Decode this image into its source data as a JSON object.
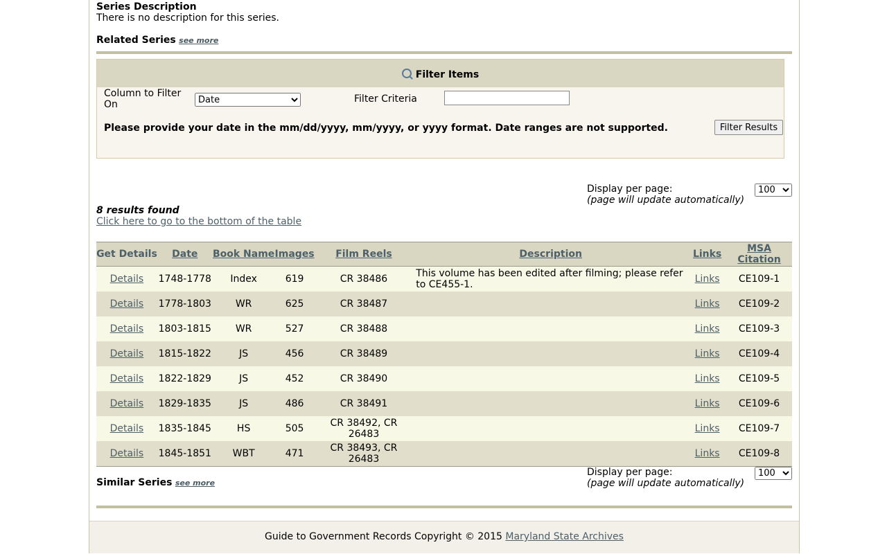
{
  "series_description": {
    "heading": "Series Description",
    "text": "There is no description for this series."
  },
  "related_series": {
    "heading": "Related Series",
    "see_more": "see more"
  },
  "filter": {
    "title": "Filter Items",
    "column_label": "Column to Filter On",
    "column_selected": "Date",
    "criteria_label": "Filter Criteria",
    "criteria_value": "",
    "hint": "Please provide your date in the mm/dd/yyyy, mm/yyyy, or yyyy format. Date ranges are not supported.",
    "button": "Filter Results"
  },
  "display_top": {
    "label": "Display per page:",
    "note": "(page will update automatically)",
    "selected": "100"
  },
  "results": {
    "count_text": "8 results found",
    "bottom_link": "Click here to go to the bottom of the table"
  },
  "table": {
    "headers": {
      "get_details": "Get Details",
      "date": "Date",
      "book_name": "Book Name",
      "images": "Images",
      "film_reels": "Film Reels",
      "description": "Description",
      "links": "Links",
      "msa_citation": "MSA Citation"
    },
    "rows": [
      {
        "details": "Details",
        "date": "1748-1778",
        "book": "Index",
        "images": "619",
        "reels": "CR 38486",
        "description": "This volume has been edited after filming; please refer to CE455-1.",
        "links": "Links",
        "citation": "CE109-1"
      },
      {
        "details": "Details",
        "date": "1778-1803",
        "book": "WR",
        "images": "625",
        "reels": "CR 38487",
        "description": "",
        "links": "Links",
        "citation": "CE109-2"
      },
      {
        "details": "Details",
        "date": "1803-1815",
        "book": "WR",
        "images": "527",
        "reels": "CR 38488",
        "description": "",
        "links": "Links",
        "citation": "CE109-3"
      },
      {
        "details": "Details",
        "date": "1815-1822",
        "book": "JS",
        "images": "456",
        "reels": "CR 38489",
        "description": "",
        "links": "Links",
        "citation": "CE109-4"
      },
      {
        "details": "Details",
        "date": "1822-1829",
        "book": "JS",
        "images": "452",
        "reels": "CR 38490",
        "description": "",
        "links": "Links",
        "citation": "CE109-5"
      },
      {
        "details": "Details",
        "date": "1829-1835",
        "book": "JS",
        "images": "486",
        "reels": "CR 38491",
        "description": "",
        "links": "Links",
        "citation": "CE109-6"
      },
      {
        "details": "Details",
        "date": "1835-1845",
        "book": "HS",
        "images": "505",
        "reels": "CR 38492, CR 26483",
        "description": "",
        "links": "Links",
        "citation": "CE109-7"
      },
      {
        "details": "Details",
        "date": "1845-1851",
        "book": "WBT",
        "images": "471",
        "reels": "CR 38493, CR 26483",
        "description": "",
        "links": "Links",
        "citation": "CE109-8"
      }
    ]
  },
  "similar_series": {
    "heading": "Similar Series",
    "see_more": "see more"
  },
  "display_bottom": {
    "label": "Display per page:",
    "note": "(page will update automatically)",
    "selected": "100"
  },
  "footer": {
    "text": "Guide to Government Records Copyright © 2015",
    "link": "Maryland State Archives"
  },
  "colors": {
    "header_bg": "#d9d7c2",
    "row_light": "#f8f8e6",
    "row_dark": "#e1dfcc",
    "link": "#4d5f69",
    "rule": "#c2c0a0"
  }
}
